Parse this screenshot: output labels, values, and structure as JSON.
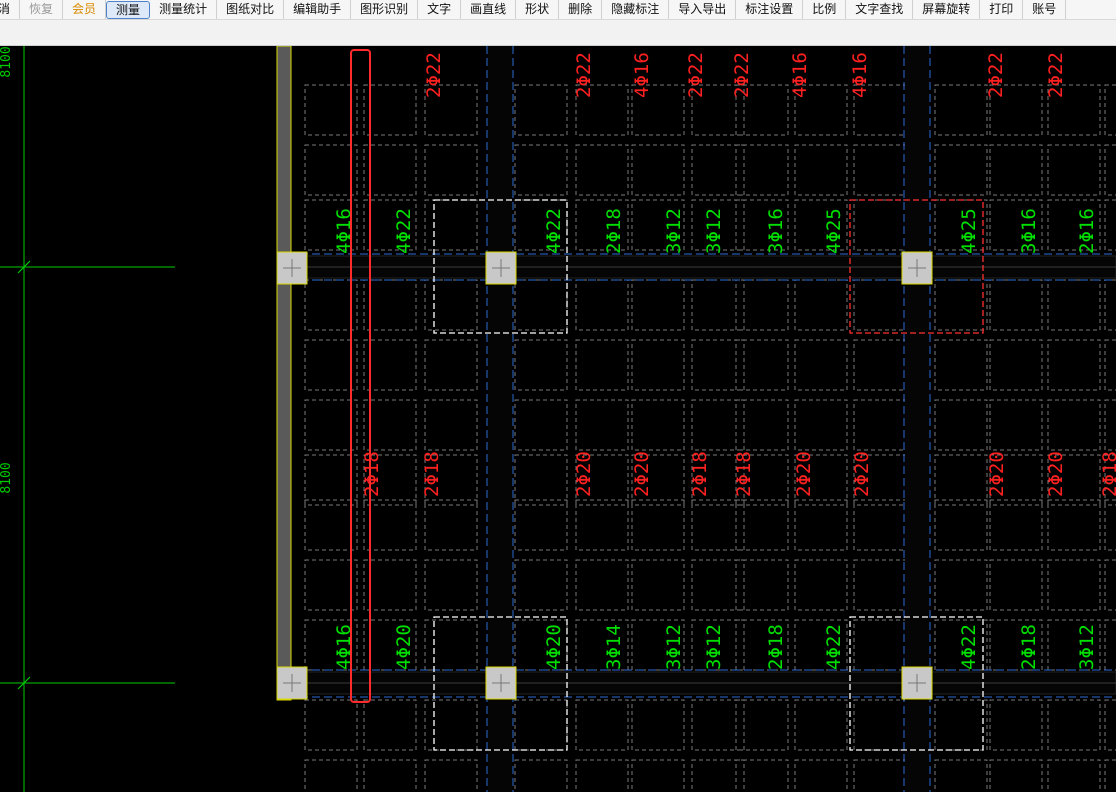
{
  "toolbar": {
    "items": [
      {
        "label": "消",
        "state": "normal"
      },
      {
        "label": "恢复",
        "state": "disabled"
      },
      {
        "label": "会员",
        "state": "vip"
      },
      {
        "label": "测量",
        "state": "active"
      },
      {
        "label": "测量统计",
        "state": "normal"
      },
      {
        "label": "图纸对比",
        "state": "normal"
      },
      {
        "label": "编辑助手",
        "state": "normal"
      },
      {
        "label": "图形识别",
        "state": "normal"
      },
      {
        "label": "文字",
        "state": "normal"
      },
      {
        "label": "画直线",
        "state": "normal"
      },
      {
        "label": "形状",
        "state": "normal"
      },
      {
        "label": "删除",
        "state": "normal"
      },
      {
        "label": "隐藏标注",
        "state": "normal"
      },
      {
        "label": "导入导出",
        "state": "normal"
      },
      {
        "label": "标注设置",
        "state": "normal"
      },
      {
        "label": "比例",
        "state": "normal"
      },
      {
        "label": "文字查找",
        "state": "normal"
      },
      {
        "label": "屏幕旋转",
        "state": "normal"
      },
      {
        "label": "打印",
        "state": "normal"
      },
      {
        "label": "账号",
        "state": "normal"
      }
    ]
  },
  "drawing": {
    "dimensions": [
      "8100",
      "8100"
    ],
    "top_labels": [
      "2Φ22",
      "2Φ22",
      "4Φ16",
      "2Φ22",
      "2Φ22",
      "4Φ16",
      "4Φ16",
      "2Φ22",
      "2Φ22"
    ],
    "upper_row_labels": [
      "4Φ16",
      "4Φ22",
      "4Φ22",
      "2Φ18",
      "3Φ12",
      "3Φ12",
      "3Φ16",
      "4Φ25",
      "4Φ25",
      "3Φ16",
      "2Φ16"
    ],
    "middle_labels": [
      "2Φ18",
      "2Φ18",
      "2Φ20",
      "2Φ20",
      "2Φ18",
      "2Φ18",
      "2Φ20",
      "2Φ20",
      "2Φ20",
      "2Φ20",
      "2Φ18"
    ],
    "lower_row_labels": [
      "4Φ16",
      "4Φ20",
      "4Φ20",
      "3Φ14",
      "3Φ12",
      "3Φ12",
      "2Φ18",
      "4Φ22",
      "4Φ22",
      "2Φ18",
      "3Φ12"
    ],
    "colors": {
      "label_green": "#00e000",
      "label_red": "#ff2020",
      "grid_dash": "#7a7a7a",
      "axis_blue": "#2e6bd8",
      "column_fill": "#c8c8c8",
      "column_border": "#d8d800",
      "highlight_red": "#ff2a2a",
      "dimension_green": "#00cc00"
    }
  }
}
